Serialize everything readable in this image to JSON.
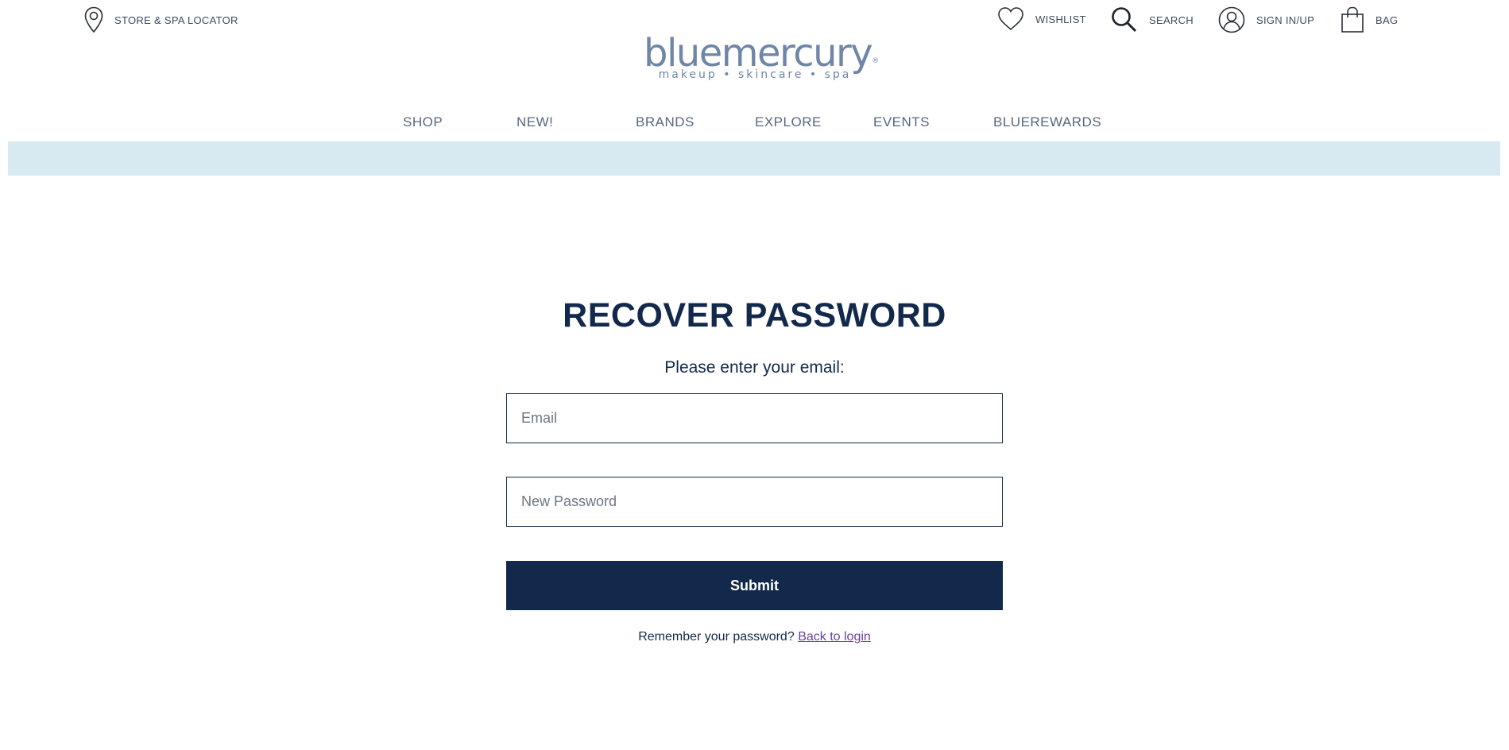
{
  "utility": {
    "locator_label": "STORE & SPA LOCATOR",
    "wishlist_label": "WISHLIST",
    "search_label": "SEARCH",
    "signin_label": "SIGN IN/UP",
    "bag_label": "BAG"
  },
  "logo": {
    "wordmark": "bluemercury",
    "registered": "®",
    "tagline": "makeup • skincare • spa"
  },
  "nav": {
    "items": [
      "SHOP",
      "NEW!",
      "BRANDS",
      "EXPLORE",
      "EVENTS",
      "BLUEREWARDS"
    ]
  },
  "colors": {
    "navy": "#13294b",
    "promo_band": "#d7eaf1",
    "logo_blue": "#6f86a6",
    "link_purple": "#6b3fa0"
  },
  "form": {
    "title": "RECOVER PASSWORD",
    "subtitle": "Please enter your email:",
    "email_placeholder": "Email",
    "email_value": "",
    "new_password_placeholder": "New Password",
    "new_password_value": "",
    "submit_label": "Submit",
    "remember_text": "Remember your password?",
    "back_link": "Back to login"
  },
  "icons": {
    "locator": "map-pin-icon",
    "wishlist": "heart-icon",
    "search": "search-icon",
    "signin": "user-icon",
    "bag": "shopping-bag-icon"
  }
}
